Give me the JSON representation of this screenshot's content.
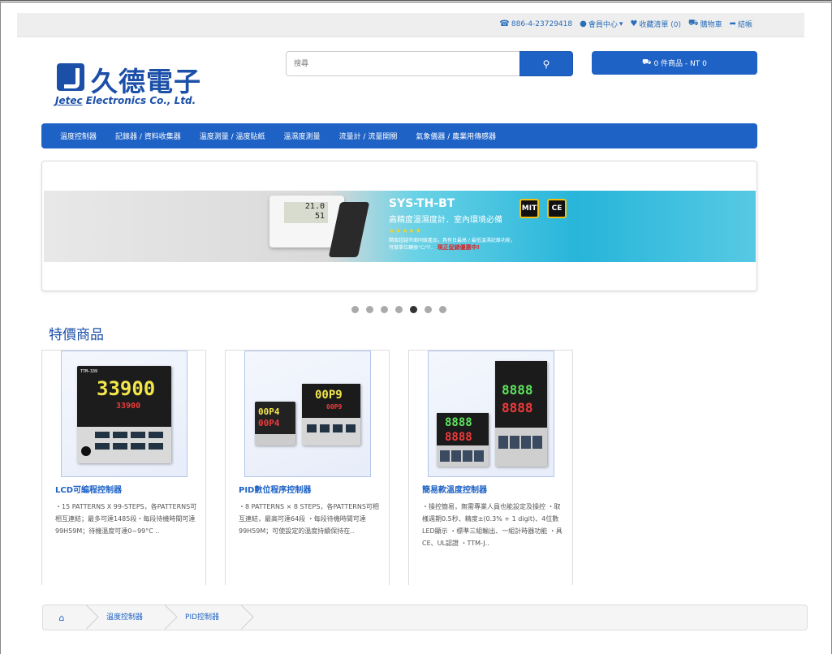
{
  "topbar": {
    "phone": "886-4-23729418",
    "member": "會員中心",
    "wishlist": "收藏清單 (0)",
    "cart": "購物車",
    "checkout": "結帳"
  },
  "logo": {
    "chinese": "久德電子",
    "english_prefix": "Jetec",
    "english_rest": " Electronics Co., Ltd."
  },
  "search": {
    "placeholder": "搜尋"
  },
  "cart_button": {
    "label": "0 件商品 - NT 0"
  },
  "menu": [
    "溫度控制器",
    "記錄器 / 資料收集器",
    "溫度測量 / 溫度貼紙",
    "溫濕度測量",
    "流量計 / 流量開關",
    "氣象儀器 / 農業用傳感器"
  ],
  "banner": {
    "device_reading_1": "21.0",
    "device_reading_2": "51",
    "product_title": "SYS-TH-BT",
    "subtitle": "高精度溫濕度計．室內環境必備",
    "stars": "★★★★★",
    "desc_line1": "精度超越市面同級產品，具有日最高 / 最低溫濕記錄功能，",
    "desc_line2": "可做單位轉換°C/°F",
    "promo": "現正促銷優惠中!",
    "badge_mit": "MIT",
    "badge_ce": "CE"
  },
  "carousel": {
    "slides": 7,
    "active_index": 4
  },
  "section_title": "特價商品",
  "products": [
    {
      "name": "LCD可編程控制器",
      "desc": "・15 PATTERNS X 99-STEPS，各PATTERNS可相互連結；最多可達1485段・每段待機時間可達99H59M；待機溫度可達0~99°C ..",
      "display_main": "33900",
      "display_sub": "33900",
      "model": "TTM-339"
    },
    {
      "name": "PID數位程序控制器",
      "desc": "・8 PATTERNS × 8 STEPS，各PATTERNS可相互連結，最高可達64段 ・每段待機時間可達99H59M；可使設定的溫度持續保持在..",
      "display_a1": "00P4",
      "display_a2": "00P4",
      "display_b1": "00P9",
      "display_b2": "00P9"
    },
    {
      "name": "簡易款溫度控制器",
      "desc": "・操控簡易，無需專業人員也能設定及操控 ・取樣週期0.5秒、精度±(0.3% + 1 digit)、4位數LED顯示 ・標準三組輸出、一組計時器功能 ・具CE、UL認證 ・TTM-J..",
      "display_a1": "8888",
      "display_a2": "8888",
      "display_b1": "8888",
      "display_b2": "8888"
    }
  ],
  "breadcrumb": [
    "溫度控制器",
    "PID控制器"
  ],
  "colors": {
    "primary": "#1e62c6",
    "brand": "#1b4fa8"
  }
}
